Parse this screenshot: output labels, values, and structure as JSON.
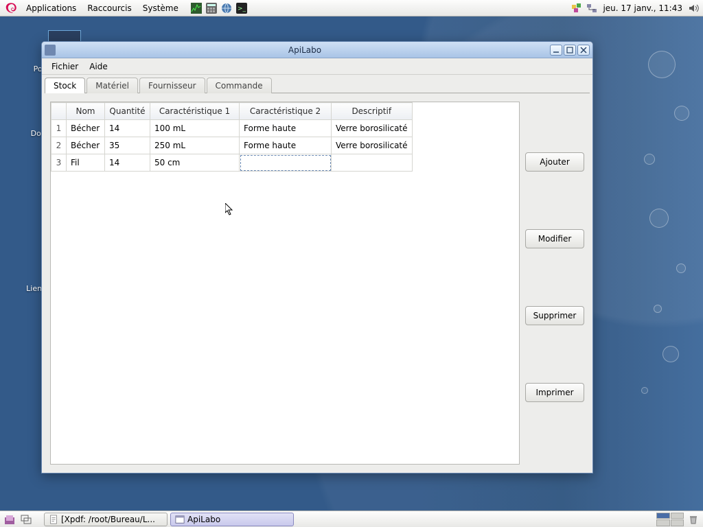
{
  "panel": {
    "menus": [
      "Applications",
      "Raccourcis",
      "Système"
    ],
    "clock": "jeu. 17 janv., 11:43"
  },
  "desktop_icons": [
    {
      "label": "Pos"
    },
    {
      "label": "Doss"
    },
    {
      "label": "Lien ve"
    }
  ],
  "window": {
    "title": "ApiLabo",
    "menus": [
      "Fichier",
      "Aide"
    ],
    "tabs": [
      "Stock",
      "Matériel",
      "Fournisseur",
      "Commande"
    ],
    "buttons": {
      "add": "Ajouter",
      "edit": "Modifier",
      "del": "Supprimer",
      "print": "Imprimer"
    },
    "table": {
      "headers": [
        "",
        "Nom",
        "Quantité",
        "Caractéristique 1",
        "Caractéristique 2",
        "Descriptif"
      ],
      "rows": [
        {
          "n": "1",
          "nom": "Bécher",
          "qte": "14",
          "c1": "100 mL",
          "c2": "Forme haute",
          "desc": "Verre borosilicaté"
        },
        {
          "n": "2",
          "nom": "Bécher",
          "qte": "35",
          "c1": "250 mL",
          "c2": "Forme haute",
          "desc": "Verre borosilicaté"
        },
        {
          "n": "3",
          "nom": "Fil",
          "qte": "14",
          "c1": "50 cm",
          "c2": "",
          "desc": ""
        }
      ]
    }
  },
  "taskbar": {
    "tasks": [
      {
        "label": "[Xpdf: /root/Bureau/L...",
        "active": false
      },
      {
        "label": "ApiLabo",
        "active": true
      }
    ]
  }
}
